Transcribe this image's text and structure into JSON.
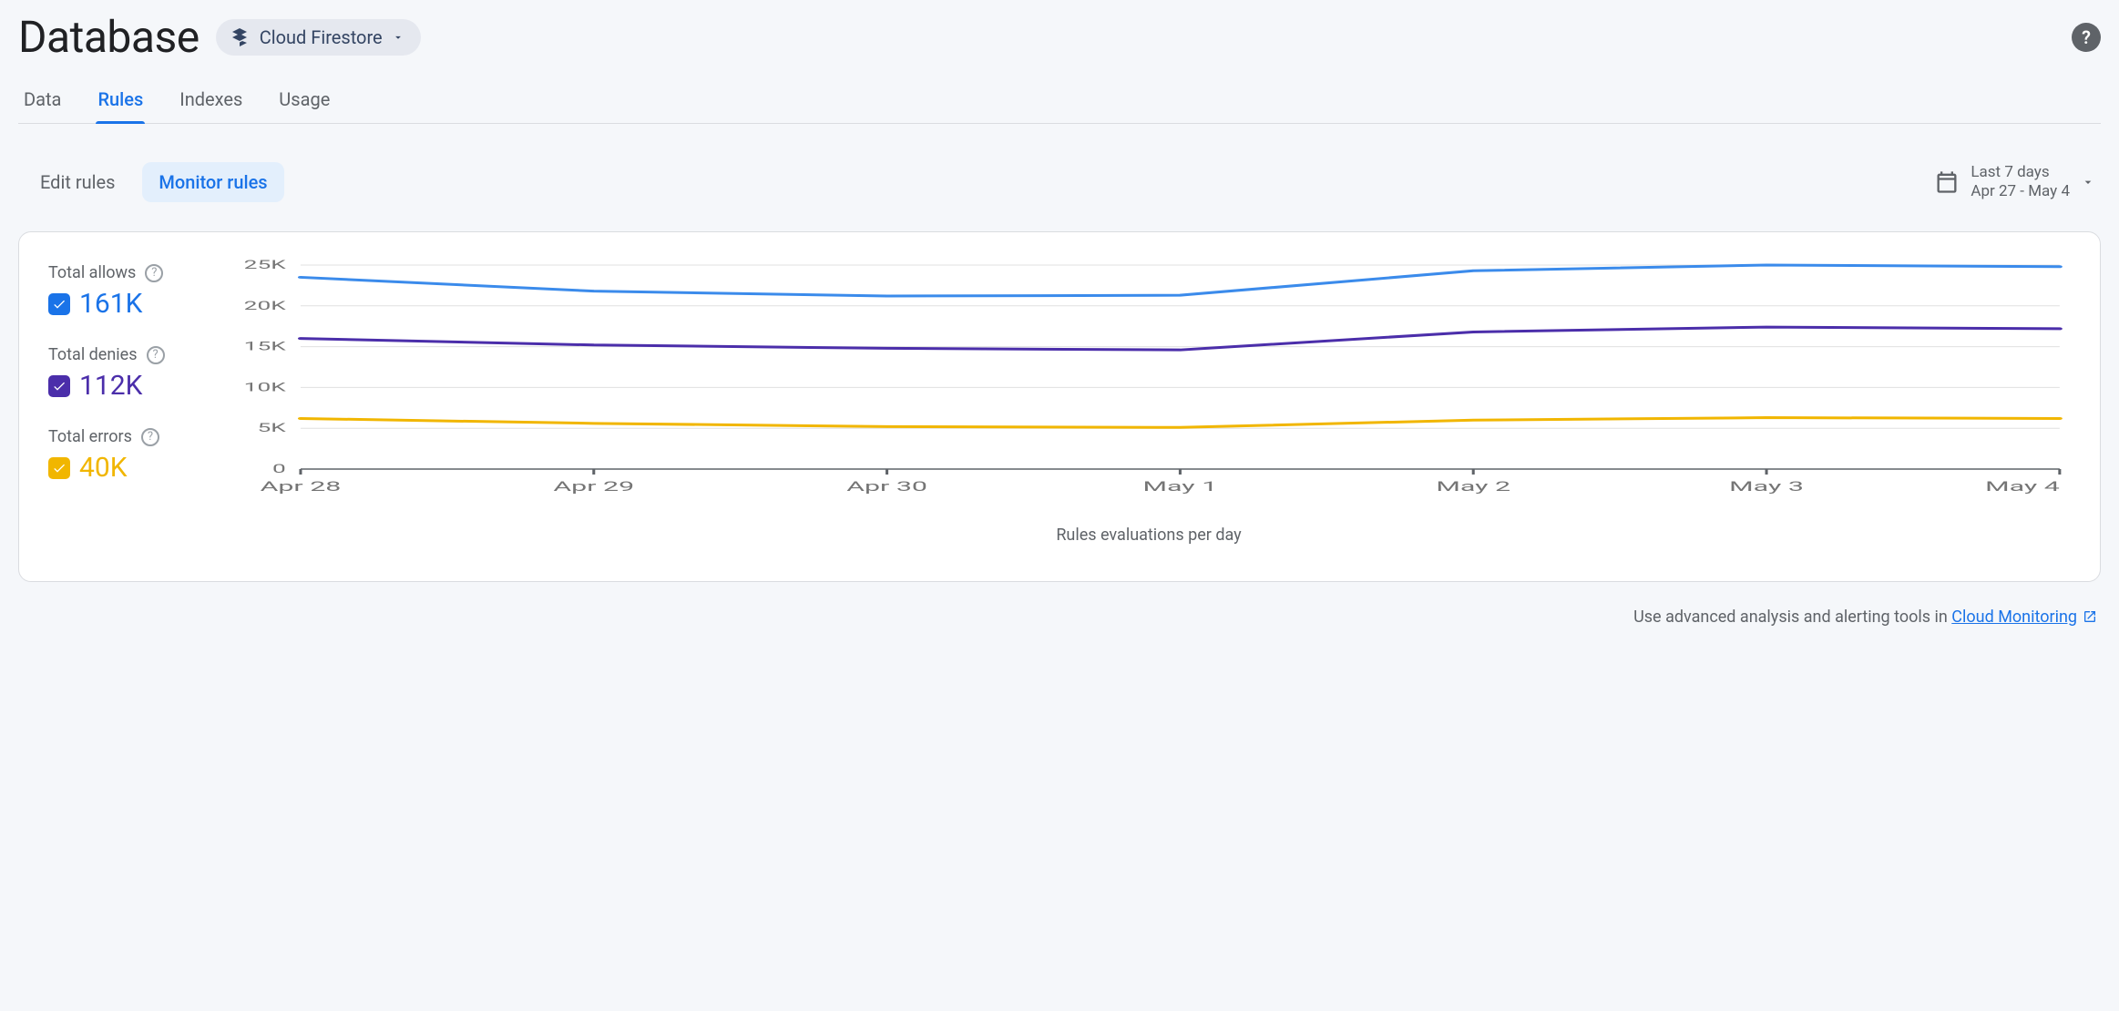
{
  "header": {
    "title": "Database",
    "selector": {
      "label": "Cloud Firestore"
    },
    "help_tooltip": "?"
  },
  "tabs": [
    {
      "id": "data",
      "label": "Data",
      "active": false
    },
    {
      "id": "rules",
      "label": "Rules",
      "active": true
    },
    {
      "id": "indexes",
      "label": "Indexes",
      "active": false
    },
    {
      "id": "usage",
      "label": "Usage",
      "active": false
    }
  ],
  "subtabs": [
    {
      "id": "edit",
      "label": "Edit rules",
      "active": false
    },
    {
      "id": "monitor",
      "label": "Monitor rules",
      "active": true
    }
  ],
  "date_range": {
    "preset": "Last 7 days",
    "range_text": "Apr 27 - May 4"
  },
  "legend": {
    "allows": {
      "title": "Total allows",
      "value": "161K",
      "color": "#1a73e8"
    },
    "denies": {
      "title": "Total denies",
      "value": "112K",
      "color": "#4b2eaa"
    },
    "errors": {
      "title": "Total errors",
      "value": "40K",
      "color": "#f1b600"
    }
  },
  "chart_data": {
    "type": "line",
    "title": "",
    "xlabel": "Rules evaluations per day",
    "ylabel": "",
    "ylim": [
      0,
      25000
    ],
    "y_ticks": [
      0,
      5000,
      10000,
      15000,
      20000,
      25000
    ],
    "y_tick_labels": [
      "0",
      "5K",
      "10K",
      "15K",
      "20K",
      "25K"
    ],
    "categories": [
      "Apr 28",
      "Apr 29",
      "Apr 30",
      "May 1",
      "May 2",
      "May 3",
      "May 4"
    ],
    "series": [
      {
        "name": "Total allows",
        "color": "#3b8beb",
        "values": [
          23500,
          21800,
          21200,
          21300,
          24300,
          25000,
          24800
        ]
      },
      {
        "name": "Total denies",
        "color": "#4b2eaa",
        "values": [
          16000,
          15200,
          14800,
          14600,
          16800,
          17400,
          17200
        ]
      },
      {
        "name": "Total errors",
        "color": "#f1b600",
        "values": [
          6200,
          5600,
          5200,
          5100,
          6000,
          6300,
          6200
        ]
      }
    ]
  },
  "footer": {
    "prefix": "Use advanced analysis and alerting tools in ",
    "link_text": "Cloud Monitoring"
  }
}
